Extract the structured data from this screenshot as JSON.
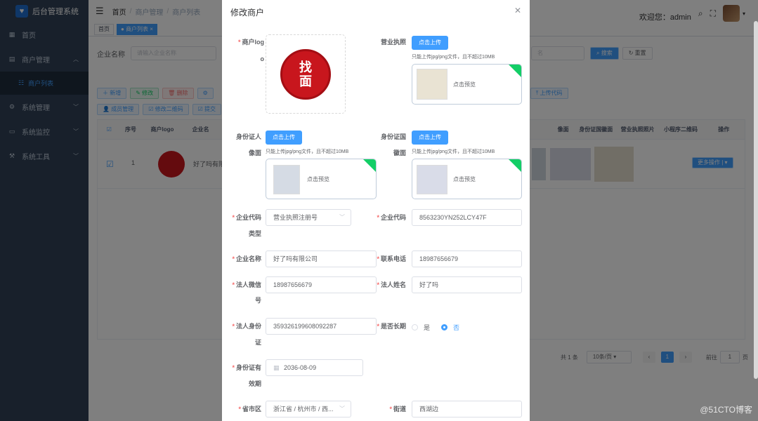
{
  "app": {
    "title": "后台管理系统"
  },
  "sidebar": {
    "items": [
      {
        "label": "首页",
        "icon": "dashboard-icon"
      },
      {
        "label": "商户管理",
        "icon": "shop-icon"
      },
      {
        "label": "商户列表",
        "icon": "list-icon"
      },
      {
        "label": "系统管理",
        "icon": "gear-icon"
      },
      {
        "label": "系统监控",
        "icon": "monitor-icon"
      },
      {
        "label": "系统工具",
        "icon": "tool-icon"
      }
    ]
  },
  "navbar": {
    "breadcrumb": [
      "首页",
      "商户管理",
      "商户列表"
    ],
    "welcome": "欢迎您：admin"
  },
  "tags": [
    "首页",
    "商户列表"
  ],
  "search": {
    "label": "企业名称",
    "placeholder": "请输入企业名称",
    "search_btn": "搜索",
    "reset_btn": "重置",
    "third_placeholder": "名"
  },
  "toolbar": {
    "add": "新增",
    "edit": "修改",
    "delete": "删除",
    "upload_code": "上传代码",
    "members": "成员管理",
    "qrcode": "修改二维码",
    "submit": "提交"
  },
  "table": {
    "headers_left": [
      "序号",
      "商户logo",
      "企业名"
    ],
    "headers_right": [
      "像面",
      "身份证国徽面",
      "营业执照照片",
      "小程序二维码",
      "操作"
    ],
    "row": {
      "index": "1",
      "company_partial": "好了吗有限",
      "more_ops": "更多操作"
    }
  },
  "pager": {
    "total": "共 1 条",
    "page_size": "10条/页",
    "current": "1",
    "goto": "前往",
    "goto_page": "1",
    "page_unit": "页"
  },
  "dialog": {
    "title": "修改商户",
    "labels": {
      "logo_1": "商户log",
      "logo_2": "o",
      "license": "营业执照",
      "id_front_1": "身份证人",
      "id_front_2": "像面",
      "id_back_1": "身份证国",
      "id_back_2": "徽面",
      "code_type_1": "企业代码",
      "code_type_2": "类型",
      "code": "企业代码",
      "company": "企业名称",
      "phone": "联系电话",
      "wechat_1": "法人微信",
      "wechat_2": "号",
      "legal_name": "法人姓名",
      "legal_id_1": "法人身份",
      "legal_id_2": "证",
      "long_term": "是否长期",
      "expiry_1": "身份证有",
      "expiry_2": "效期",
      "region": "省市区",
      "street": "街道"
    },
    "upload_btn": "点击上传",
    "upload_tip": "只能上传jpg/png文件，且不超过10MB",
    "preview_text": "点击预览",
    "values": {
      "code_type": "营业执照注册号",
      "code": "8563230YN252LCY47F",
      "company": "好了吗有限公司",
      "phone": "18987656679",
      "wechat": "18987656679",
      "legal_name": "好了吗",
      "legal_id": "359326199608092287",
      "expiry": "2036-08-09",
      "region": "浙江省 / 杭州市 / 西...",
      "street": "西湖边"
    },
    "radio": {
      "yes": "是",
      "no": "否",
      "selected": "否"
    },
    "seal_text_1": "找",
    "seal_text_2": "面"
  },
  "watermark": "@51CTO博客",
  "colors": {
    "primary": "#409eff",
    "sidebar": "#304156",
    "danger": "#f56c6c",
    "success": "#13ce66"
  }
}
